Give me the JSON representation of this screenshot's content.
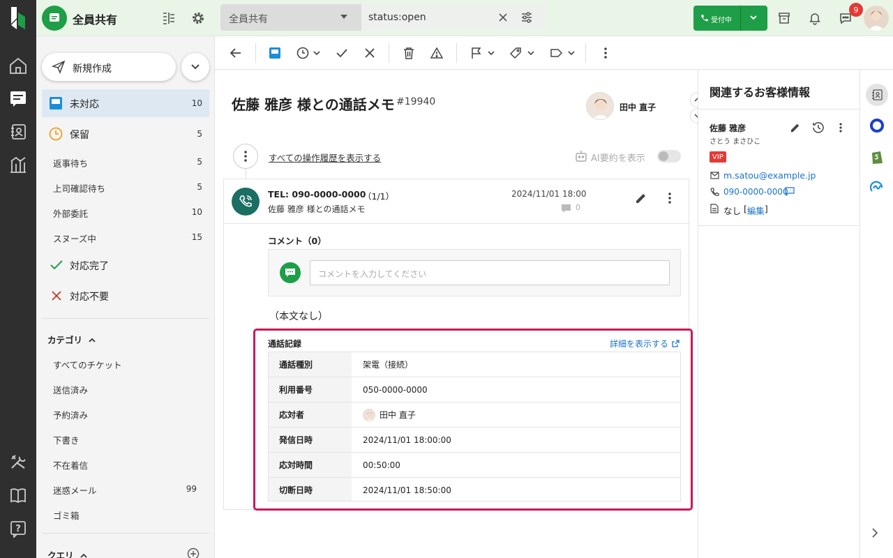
{
  "header": {
    "workspace": "全員共有",
    "filter_select": "全員共有",
    "search_value": "status:open",
    "reception_label": "受付中",
    "chat_badge": "9"
  },
  "sidebar": {
    "new_button": "新規作成",
    "items": [
      {
        "label": "未対応",
        "count": "10"
      },
      {
        "label": "保留",
        "count": "5"
      }
    ],
    "sub_items": [
      {
        "label": "返事待ち",
        "count": "5"
      },
      {
        "label": "上司確認待ち",
        "count": "5"
      },
      {
        "label": "外部委託",
        "count": "10"
      },
      {
        "label": "スヌーズ中",
        "count": "15"
      }
    ],
    "done": "対応完了",
    "unneeded": "対応不要",
    "category_title": "カテゴリ",
    "categories": [
      {
        "label": "すべてのチケット",
        "count": ""
      },
      {
        "label": "送信済み",
        "count": ""
      },
      {
        "label": "予約済み",
        "count": ""
      },
      {
        "label": "下書き",
        "count": ""
      },
      {
        "label": "不在着信",
        "count": ""
      },
      {
        "label": "迷惑メール",
        "count": "99"
      },
      {
        "label": "ゴミ箱",
        "count": ""
      }
    ],
    "query_title": "クエリ"
  },
  "ticket": {
    "title": "佐藤 雅彦 様との通話メモ",
    "number": "#19940",
    "assignee": "田中 直子",
    "history_link": "すべての操作履歴を表示する",
    "ai_summary": "AI要約を表示",
    "message": {
      "tel": "TEL: 090-0000-0000",
      "page": "（1/1）",
      "subject": "佐藤 雅彦 様との通話メモ",
      "datetime": "2024/11/01 18:00",
      "comment_count": "0"
    },
    "comment_title": "コメント（0）",
    "comment_placeholder": "コメントを入力してください",
    "body": "（本文なし）",
    "call_log": {
      "title": "通話記録",
      "detail_link": "詳細を表示する",
      "rows": [
        {
          "key": "通話種別",
          "value": "架電（接続）"
        },
        {
          "key": "利用番号",
          "value": "050-0000-0000"
        },
        {
          "key": "応対者",
          "value": "田中 直子"
        },
        {
          "key": "発信日時",
          "value": "2024/11/01 18:00:00"
        },
        {
          "key": "応対時間",
          "value": "00:50:00"
        },
        {
          "key": "切断日時",
          "value": "2024/11/01 18:50:00"
        }
      ]
    }
  },
  "customer": {
    "panel_title": "関連するお客様情報",
    "name": "佐藤 雅彦",
    "kana": "さとう まさひこ",
    "tag": "VIP",
    "email": "m.satou@example.jp",
    "phone": "090-0000-0000",
    "note_prefix": "なし",
    "note_bracket_open": "[",
    "note_edit": "編集",
    "note_bracket_close": "]"
  },
  "colors": {
    "brand_green": "#1e9e46",
    "highlight": "#c8195a",
    "link": "#1a73c8",
    "vip": "#e53935"
  }
}
